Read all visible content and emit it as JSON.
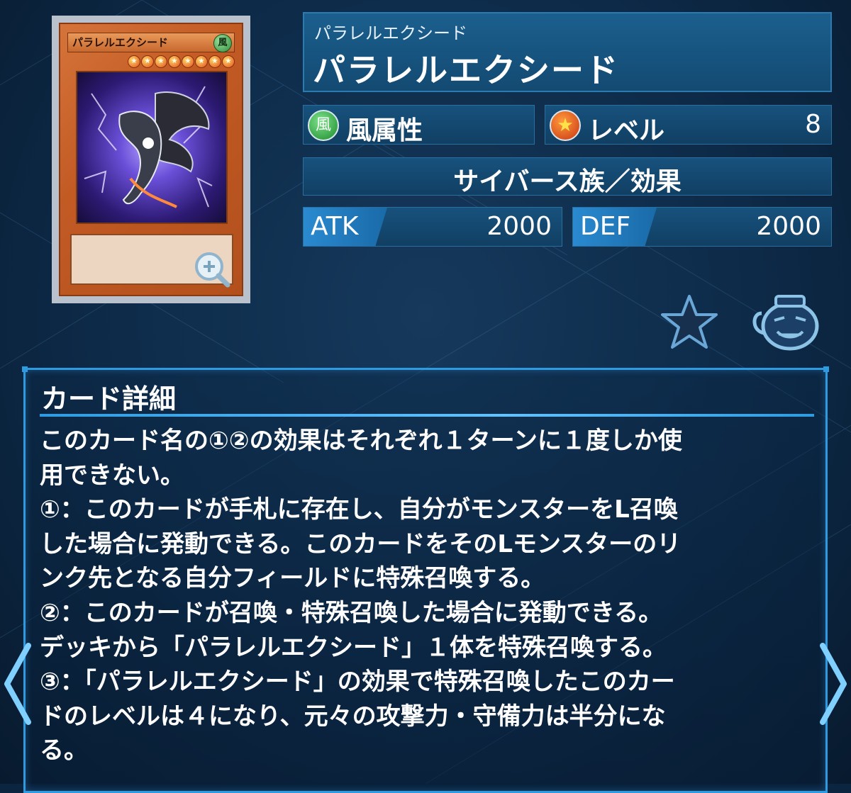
{
  "card": {
    "image_name": "パラレルエクシード",
    "attribute_glyph": "風",
    "level_stars": [
      "★",
      "★",
      "★",
      "★",
      "★",
      "★",
      "★",
      "★"
    ],
    "art_color": "#6a4fd8",
    "frame_color": "#c25a24"
  },
  "name": {
    "ruby": "パラレルエクシード",
    "main": "パラレルエクシード"
  },
  "attribute": {
    "icon": "wind-attribute-icon",
    "glyph": "風",
    "label": "風属性"
  },
  "level": {
    "icon": "level-star-icon",
    "glyph": "★",
    "label": "レベル",
    "value": "8"
  },
  "race": {
    "label": "サイバース族／効果"
  },
  "atk": {
    "label": "ATK",
    "value": "2000"
  },
  "def": {
    "label": "DEF",
    "value": "2000"
  },
  "actions": {
    "favorite_icon": "star-icon",
    "pot_icon": "pot-of-greed-icon"
  },
  "detail": {
    "title": "カード詳細",
    "text": "このカード名の①②の効果はそれぞれ１ターンに１度しか使\n用できない。\n①：このカードが手札に存在し、自分がモンスターをL召喚\nした場合に発動できる。このカードをそのLモンスターのリ\nンク先となる自分フィールドに特殊召喚する。\n②：このカードが召喚・特殊召喚した場合に発動できる。\nデッキから「パラレルエクシード」１体を特殊召喚する。\n③：「パラレルエクシード」の効果で特殊召喚したこのカー\nドのレベルは４になり、元々の攻撃力・守備力は半分にな\nる。"
  },
  "colors": {
    "background": "#0b2540",
    "panel": "#17527d",
    "accent": "#2e9be0",
    "stat_tag": "#2a8ad0"
  }
}
